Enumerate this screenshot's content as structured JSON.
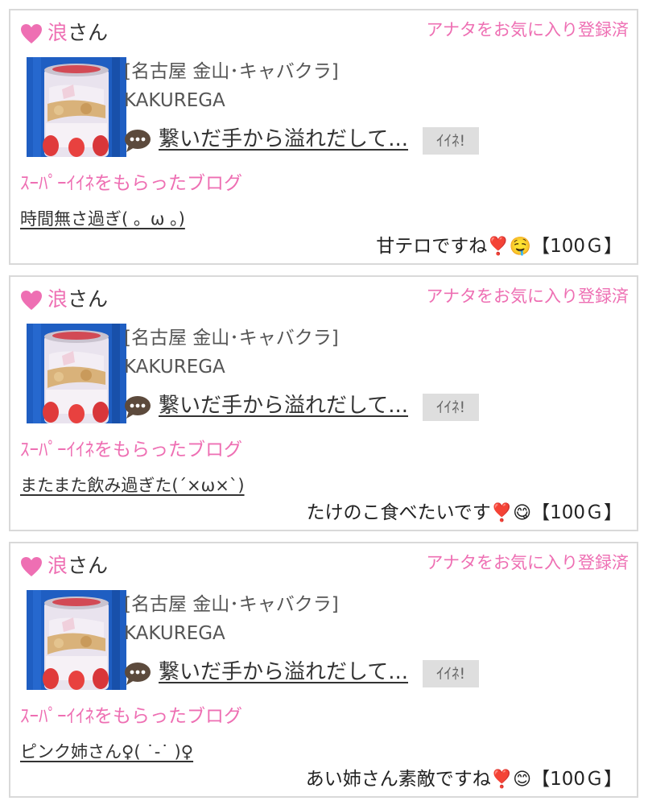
{
  "colors": {
    "accent": "#ee6fb3",
    "border": "#d9d9d9",
    "iine_bg": "#dedede",
    "thumb_bg": "#1f5ec2"
  },
  "cards": [
    {
      "user": "浪",
      "user_suffix": "さん",
      "favorite_status": "アナタをお気に入り登録済",
      "area": "[名古屋 金山･キャバクラ]",
      "shop": "KAKUREGA",
      "blog_title": "繋いだ手から溢れだして...",
      "iine_label": "ｲｲﾈ!",
      "super_label": "ｽｰﾊﾟｰｲｲﾈをもらったブログ",
      "post_title": "時間無さ過ぎ( 。ω 。)",
      "comment_text": "甘テロですね",
      "comment_emoji": "❣️🤤",
      "points": "【100Ｇ】"
    },
    {
      "user": "浪",
      "user_suffix": "さん",
      "favorite_status": "アナタをお気に入り登録済",
      "area": "[名古屋 金山･キャバクラ]",
      "shop": "KAKUREGA",
      "blog_title": "繋いだ手から溢れだして...",
      "iine_label": "ｲｲﾈ!",
      "super_label": "ｽｰﾊﾟｰｲｲﾈをもらったブログ",
      "post_title": "またまた飲み過ぎた(´×ω×`)",
      "comment_text": "たけのこ食べたいです",
      "comment_emoji": "❣️😋",
      "points": "【100Ｇ】"
    },
    {
      "user": "浪",
      "user_suffix": "さん",
      "favorite_status": "アナタをお気に入り登録済",
      "area": "[名古屋 金山･キャバクラ]",
      "shop": "KAKUREGA",
      "blog_title": "繋いだ手から溢れだして...",
      "iine_label": "ｲｲﾈ!",
      "super_label": "ｽｰﾊﾟｰｲｲﾈをもらったブログ",
      "post_title": "ピンク姉さん♀( ˙-˙ )♀",
      "comment_text": "あい姉さん素敵ですね",
      "comment_emoji": "❣️😊",
      "points": "【100Ｇ】"
    }
  ]
}
